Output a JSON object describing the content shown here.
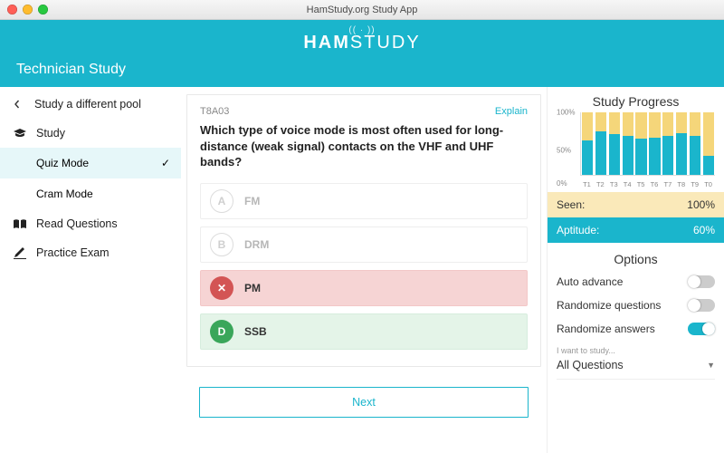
{
  "window": {
    "title": "HamStudy.org Study App"
  },
  "header": {
    "brand_left": "HAM",
    "brand_right": "STUDY",
    "subtitle": "Technician Study"
  },
  "sidebar": {
    "back_label": "Study a different pool",
    "items": [
      {
        "label": "Study",
        "icon": "graduation-cap-icon"
      },
      {
        "label": "Read Questions",
        "icon": "book-icon"
      },
      {
        "label": "Practice Exam",
        "icon": "pencil-icon"
      }
    ],
    "study_sub": [
      {
        "label": "Quiz Mode",
        "active": true
      },
      {
        "label": "Cram Mode",
        "active": false
      }
    ]
  },
  "question": {
    "code": "T8A03",
    "explain_label": "Explain",
    "text": "Which type of voice mode is most often used for long-distance (weak signal) contacts on the VHF and UHF bands?",
    "answers": [
      {
        "letter": "A",
        "label": "FM",
        "state": "dim"
      },
      {
        "letter": "B",
        "label": "DRM",
        "state": "dim"
      },
      {
        "letter": "✕",
        "label": "PM",
        "state": "wrong"
      },
      {
        "letter": "D",
        "label": "SSB",
        "state": "right"
      }
    ],
    "next_label": "Next"
  },
  "progress": {
    "title": "Study Progress",
    "seen_label": "Seen:",
    "seen_value": "100%",
    "apt_label": "Aptitude:",
    "apt_value": "60%"
  },
  "chart_data": {
    "type": "bar",
    "title": "Study Progress",
    "xlabel": "",
    "ylabel": "",
    "ylim": [
      0,
      100
    ],
    "yticks": [
      "0%",
      "50%",
      "100%"
    ],
    "categories": [
      "T1",
      "T2",
      "T3",
      "T4",
      "T5",
      "T6",
      "T7",
      "T8",
      "T9",
      "T0"
    ],
    "series": [
      {
        "name": "Seen",
        "color": "#f5d67a",
        "values": [
          100,
          100,
          100,
          100,
          100,
          100,
          100,
          100,
          100,
          100
        ]
      },
      {
        "name": "Aptitude",
        "color": "#1ab5cc",
        "values": [
          55,
          70,
          65,
          62,
          58,
          60,
          63,
          66,
          62,
          30
        ]
      }
    ]
  },
  "options": {
    "title": "Options",
    "rows": [
      {
        "label": "Auto advance",
        "on": false
      },
      {
        "label": "Randomize questions",
        "on": false
      },
      {
        "label": "Randomize answers",
        "on": true
      }
    ],
    "want_label": "I want to study...",
    "select_value": "All Questions"
  }
}
